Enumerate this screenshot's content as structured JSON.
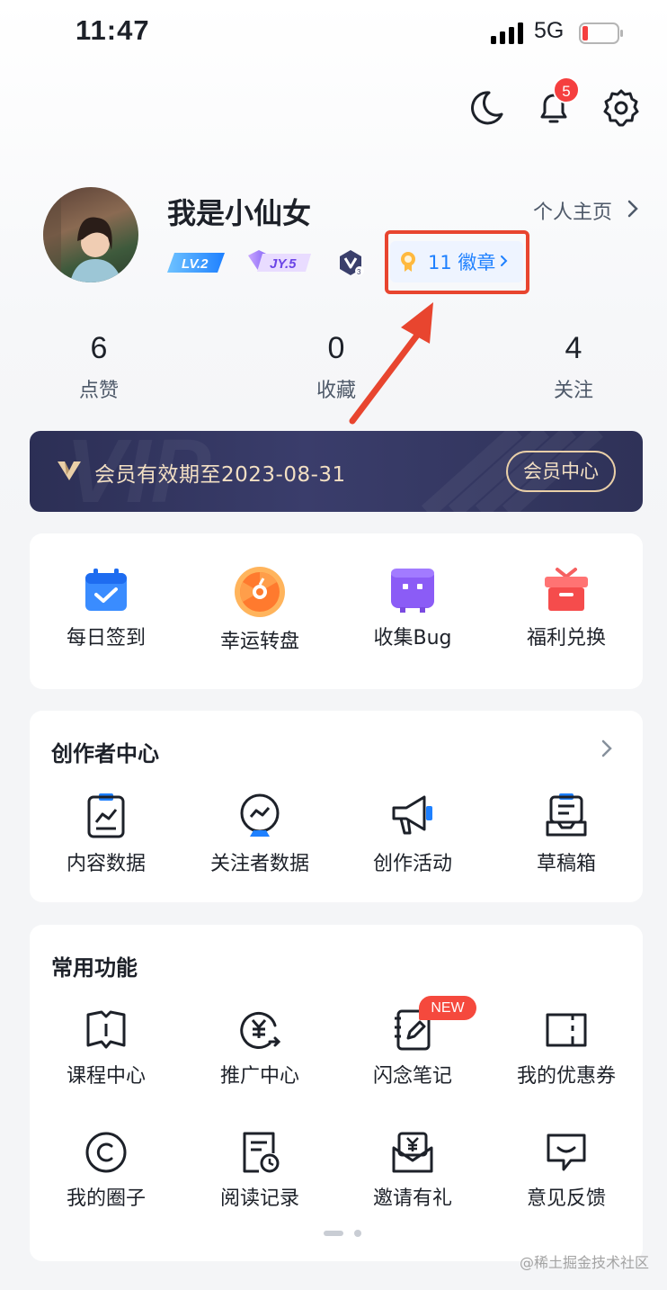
{
  "status_bar": {
    "time": "11:47",
    "network": "5G"
  },
  "notifications": {
    "badge": "5"
  },
  "profile": {
    "name": "我是小仙女",
    "homepage_link": "个人主页",
    "level_badge": "LV.2",
    "jy_badge": "JY.5",
    "v_badge_level": "3",
    "medals": "11 徽章"
  },
  "stats": [
    {
      "value": "6",
      "label": "点赞"
    },
    {
      "value": "0",
      "label": "收藏"
    },
    {
      "value": "4",
      "label": "关注"
    }
  ],
  "vip": {
    "watermark": "VIP",
    "text": "会员有效期至2023-08-31",
    "button": "会员中心"
  },
  "quick_actions": [
    {
      "label": "每日签到",
      "icon": "calendar-check-icon"
    },
    {
      "label": "幸运转盘",
      "icon": "lucky-wheel-icon"
    },
    {
      "label": "收集Bug",
      "icon": "bug-box-icon"
    },
    {
      "label": "福利兑换",
      "icon": "gift-icon"
    }
  ],
  "creator_center": {
    "title": "创作者中心",
    "items": [
      {
        "label": "内容数据",
        "icon": "chart-clipboard-icon"
      },
      {
        "label": "关注者数据",
        "icon": "follower-chart-icon"
      },
      {
        "label": "创作活动",
        "icon": "megaphone-icon"
      },
      {
        "label": "草稿箱",
        "icon": "drafts-icon"
      }
    ]
  },
  "common_functions": {
    "title": "常用功能",
    "new_badge": "NEW",
    "items": [
      {
        "label": "课程中心",
        "icon": "book-icon"
      },
      {
        "label": "推广中心",
        "icon": "yuan-share-icon"
      },
      {
        "label": "闪念笔记",
        "icon": "note-pen-icon"
      },
      {
        "label": "我的优惠券",
        "icon": "coupon-icon"
      },
      {
        "label": "我的圈子",
        "icon": "circle-icon"
      },
      {
        "label": "阅读记录",
        "icon": "reading-history-icon"
      },
      {
        "label": "邀请有礼",
        "icon": "invite-gift-icon"
      },
      {
        "label": "意见反馈",
        "icon": "feedback-icon"
      }
    ]
  },
  "footer_watermark": "@稀土掘金技术社区",
  "colors": {
    "accent": "#1e80ff",
    "highlight": "#e8452f",
    "vip_gold": "#f2dfc3"
  }
}
